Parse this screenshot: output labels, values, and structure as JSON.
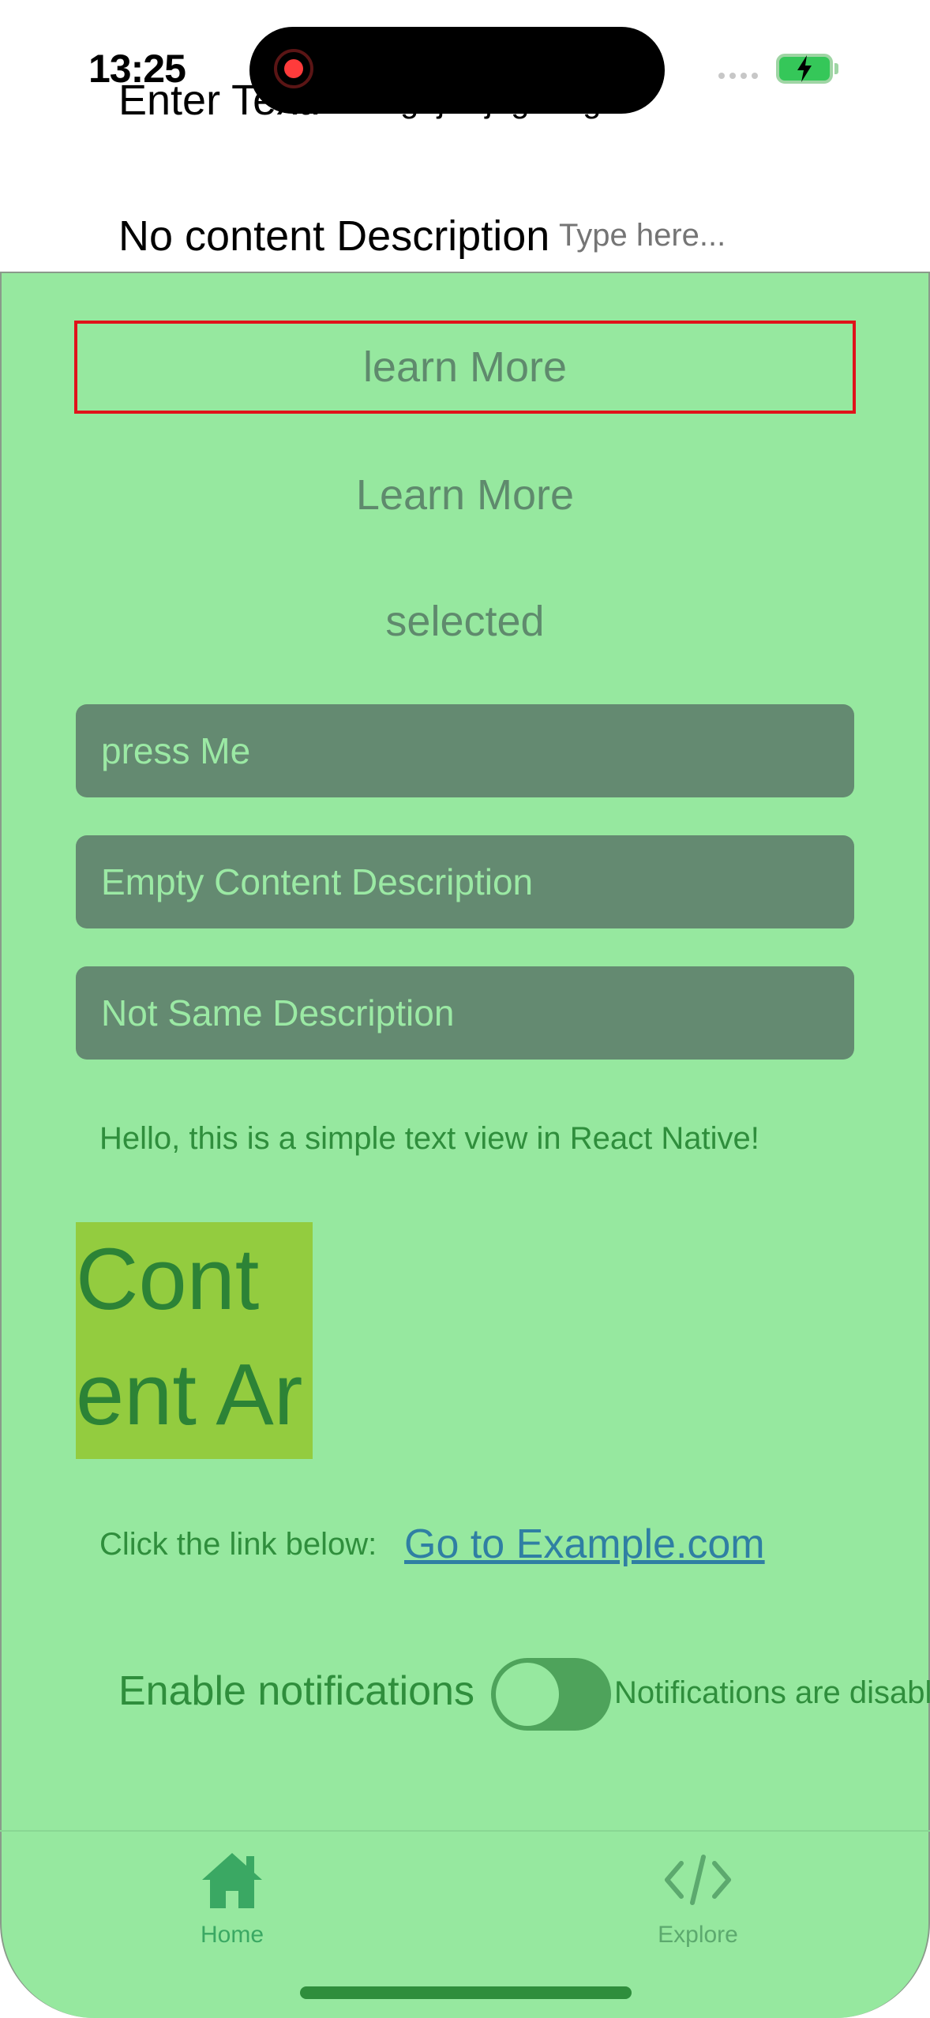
{
  "status_bar": {
    "time": "13:25"
  },
  "top_form": {
    "enter_text_label": "Enter Text:",
    "enter_text_value": "xdcfghjklkjhgfdsfg",
    "no_content_label": "No content Description",
    "no_content_placeholder": "Type here..."
  },
  "buttons": {
    "learn_more_outlined": "learn More",
    "learn_more": "Learn More",
    "selected": "selected",
    "press_me": "press Me",
    "empty_content": "Empty Content Description",
    "not_same": "Not Same Description"
  },
  "texts": {
    "hello": "Hello, this is a simple text view in React Native!",
    "content_line1": "Cont",
    "content_line2": "ent Ar",
    "click_label": "Click the link below:",
    "link_text": "Go to Example.com"
  },
  "notifications": {
    "label": "Enable notifications",
    "status": "Notifications are disabled",
    "enabled": false
  },
  "tabs": [
    {
      "label": "Home",
      "icon": "home-icon",
      "active": true
    },
    {
      "label": "Explore",
      "icon": "code-icon",
      "active": false
    }
  ],
  "colors": {
    "panel_bg": "#96e89f",
    "button_bg": "#648a71",
    "accent_red": "#e0131a",
    "text_green": "#2f8e3c",
    "link_blue": "#2f7fa3"
  }
}
